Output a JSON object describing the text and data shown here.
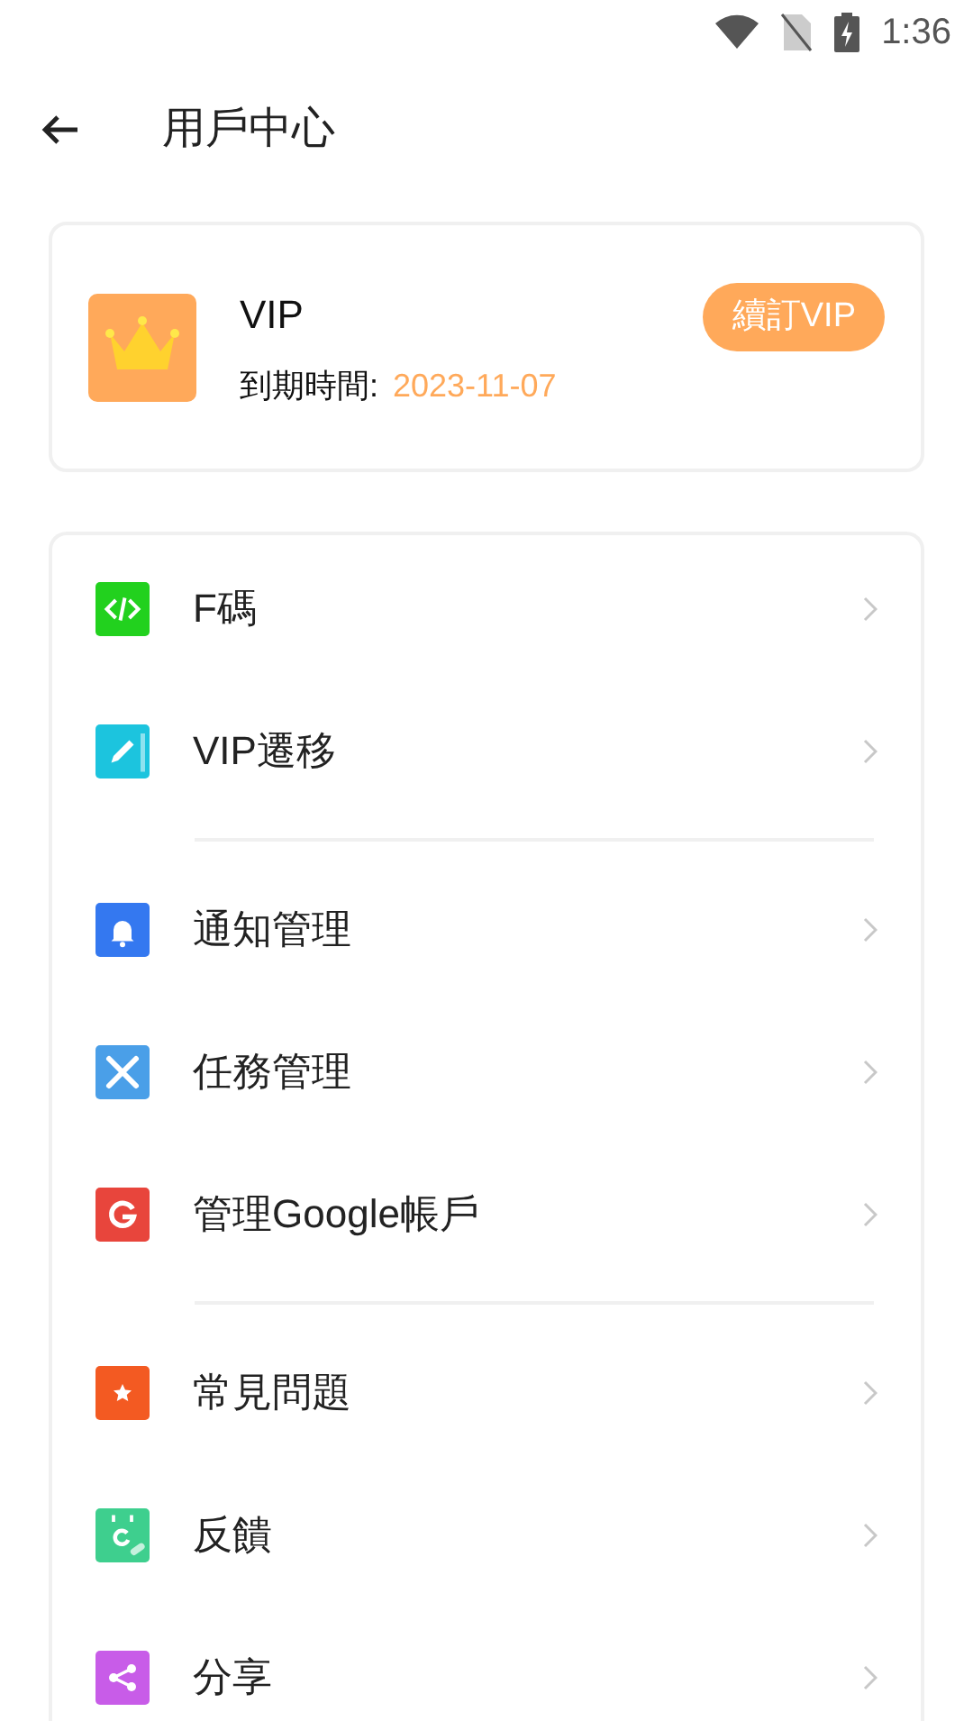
{
  "status_bar": {
    "time": "1:36"
  },
  "header": {
    "title": "用戶中心"
  },
  "vip_card": {
    "title": "VIP",
    "expiry_label": "到期時間:",
    "expiry_date": "2023-11-07",
    "renew_button": "續訂VIP"
  },
  "menu_groups": [
    {
      "items": [
        {
          "label": "F碼",
          "kind": "code",
          "color": "#22d11e"
        },
        {
          "label": "VIP遷移",
          "kind": "notebook",
          "color": "#1cc4de"
        }
      ]
    },
    {
      "items": [
        {
          "label": "通知管理",
          "kind": "bell",
          "color": "#3478f0"
        },
        {
          "label": "任務管理",
          "kind": "tools",
          "color": "#4a9fe8"
        },
        {
          "label": "管理Google帳戶",
          "kind": "google",
          "color": "#e8453c"
        }
      ]
    },
    {
      "items": [
        {
          "label": "常見問題",
          "kind": "star",
          "color": "#f35a22"
        },
        {
          "label": "反饋",
          "kind": "calendar",
          "color": "#3ecf8e"
        },
        {
          "label": "分享",
          "kind": "share",
          "color": "#c85ce8"
        }
      ]
    }
  ]
}
